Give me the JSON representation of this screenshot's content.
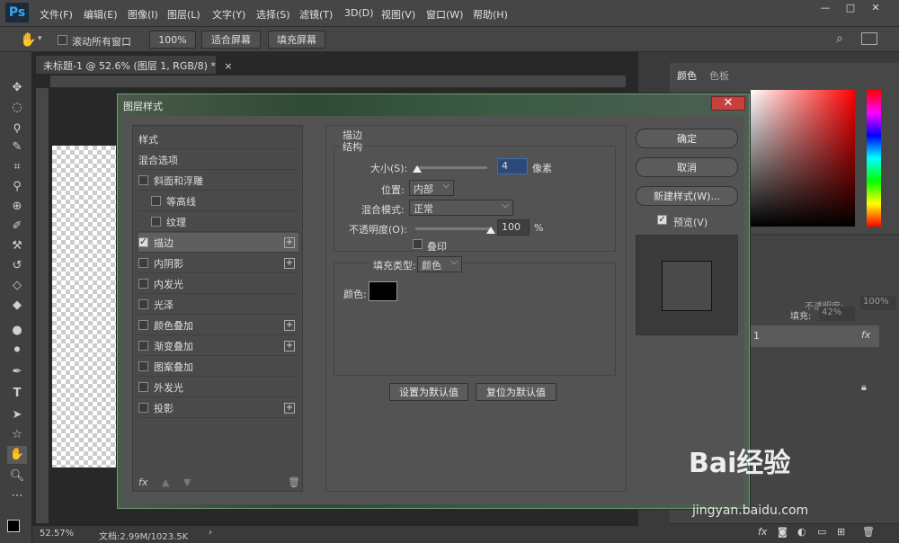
{
  "app": {
    "logo": "Ps"
  },
  "menu": [
    "文件(F)",
    "编辑(E)",
    "图像(I)",
    "图层(L)",
    "文字(Y)",
    "选择(S)",
    "滤镜(T)",
    "3D(D)",
    "视图(V)",
    "窗口(W)",
    "帮助(H)"
  ],
  "window_controls": {
    "min": "—",
    "max": "□",
    "close": "✕"
  },
  "options": {
    "scroll_all_label": "滚动所有窗口",
    "zoom_value": "100%",
    "fit_screen": "适合屏幕",
    "fill_screen": "填充屏幕"
  },
  "document": {
    "tab_title": "未标题-1 @ 52.6% (图层 1, RGB/8) *",
    "close": "×",
    "zoom": "52.57%",
    "doc_size": "文档:2.99M/1023.5K"
  },
  "panels": {
    "color_tab": "颜色",
    "swatch_tab": "色板",
    "opacity_label": "不透明度:",
    "opacity_value": "100%",
    "fill_label": "填充:",
    "fill_value": "42%",
    "layer_name": "1",
    "layer_fx": "fx"
  },
  "dialog": {
    "title": "图层样式",
    "close": "✕",
    "styles": [
      {
        "label": "样式",
        "checkbox": false,
        "plus": false,
        "indent": false,
        "selected": false
      },
      {
        "label": "混合选项",
        "checkbox": false,
        "plus": false,
        "indent": false,
        "selected": false
      },
      {
        "label": "斜面和浮雕",
        "checkbox": true,
        "checked": false,
        "plus": false,
        "indent": false,
        "selected": false
      },
      {
        "label": "等高线",
        "checkbox": true,
        "checked": false,
        "plus": false,
        "indent": true,
        "selected": false
      },
      {
        "label": "纹理",
        "checkbox": true,
        "checked": false,
        "plus": false,
        "indent": true,
        "selected": false
      },
      {
        "label": "描边",
        "checkbox": true,
        "checked": true,
        "plus": true,
        "indent": false,
        "selected": true
      },
      {
        "label": "内阴影",
        "checkbox": true,
        "checked": false,
        "plus": true,
        "indent": false,
        "selected": false
      },
      {
        "label": "内发光",
        "checkbox": true,
        "checked": false,
        "plus": false,
        "indent": false,
        "selected": false
      },
      {
        "label": "光泽",
        "checkbox": true,
        "checked": false,
        "plus": false,
        "indent": false,
        "selected": false
      },
      {
        "label": "颜色叠加",
        "checkbox": true,
        "checked": false,
        "plus": true,
        "indent": false,
        "selected": false
      },
      {
        "label": "渐变叠加",
        "checkbox": true,
        "checked": false,
        "plus": true,
        "indent": false,
        "selected": false
      },
      {
        "label": "图案叠加",
        "checkbox": true,
        "checked": false,
        "plus": false,
        "indent": false,
        "selected": false
      },
      {
        "label": "外发光",
        "checkbox": true,
        "checked": false,
        "plus": false,
        "indent": false,
        "selected": false
      },
      {
        "label": "投影",
        "checkbox": true,
        "checked": false,
        "plus": true,
        "indent": false,
        "selected": false
      }
    ],
    "fx_label": "fx",
    "stroke": {
      "section_title": "描边",
      "structure_title": "结构",
      "size_label": "大小(S):",
      "size_value": "4",
      "size_unit": "像素",
      "size_fraction": 0.02,
      "position_label": "位置:",
      "position_value": "内部",
      "blend_label": "混合模式:",
      "blend_value": "正常",
      "opacity_label": "不透明度(O):",
      "opacity_value": "100",
      "opacity_unit": "%",
      "opacity_fraction": 1.0,
      "overprint_label": "叠印",
      "fill_type_label": "填充类型:",
      "fill_type_value": "颜色",
      "color_label": "颜色:",
      "color_value": "#000000",
      "set_default": "设置为默认值",
      "reset_default": "复位为默认值"
    },
    "buttons": {
      "ok": "确定",
      "cancel": "取消",
      "new_style": "新建样式(W)...",
      "preview_label": "预览(V)"
    }
  },
  "watermark": {
    "brand": "Bai经验",
    "url": "jingyan.baidu.com"
  }
}
